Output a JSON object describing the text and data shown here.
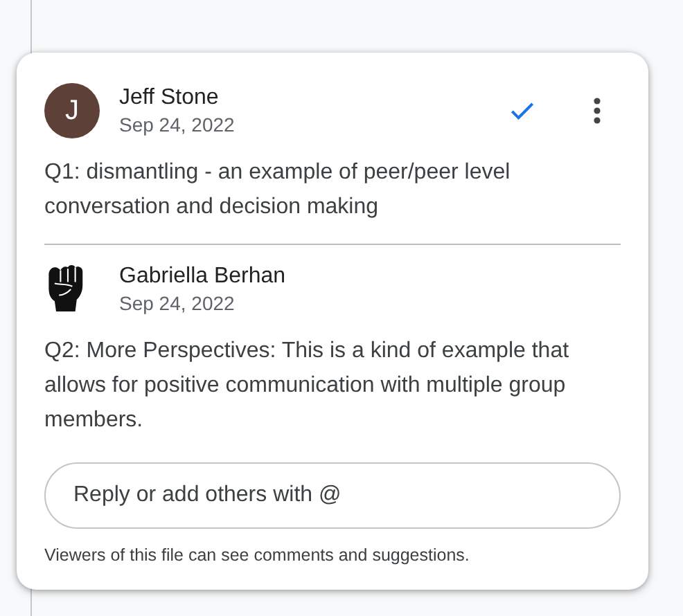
{
  "comments": [
    {
      "author": "Jeff Stone",
      "date": "Sep 24, 2022",
      "avatar": {
        "kind": "letter",
        "initial": "J"
      },
      "resolve": true,
      "menu": true,
      "text": "Q1: dismantling - an example of peer/peer level conversation and decision making"
    },
    {
      "author": "Gabriella Berhan",
      "date": "Sep 24, 2022",
      "avatar": {
        "kind": "fist"
      },
      "resolve": false,
      "menu": false,
      "text": "Q2: More Perspectives: This is a kind of example that allows for positive communication with multiple group members."
    }
  ],
  "reply": {
    "placeholder": "Reply or add others with @"
  },
  "footer": "Viewers of this file can see comments and suggestions."
}
